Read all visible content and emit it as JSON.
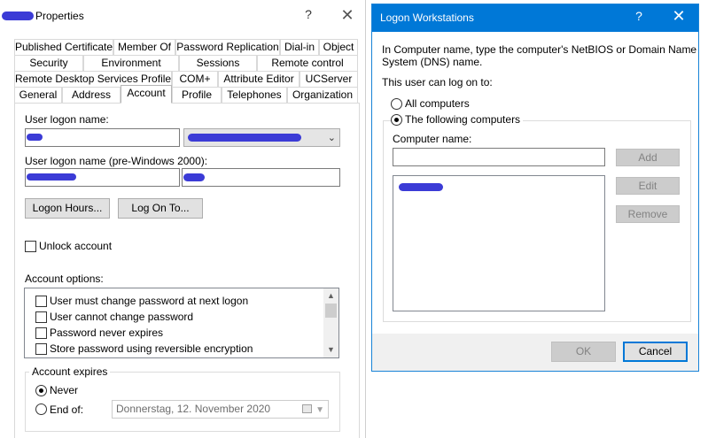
{
  "props_window": {
    "title": "Properties",
    "help": "?",
    "close": "✕",
    "tab_rows": [
      [
        "Published Certificates",
        "Member Of",
        "Password Replication",
        "Dial-in",
        "Object"
      ],
      [
        "Security",
        "Environment",
        "Sessions",
        "Remote control"
      ],
      [
        "Remote Desktop Services Profile",
        "COM+",
        "Attribute Editor",
        "UCServer"
      ],
      [
        "General",
        "Address",
        "Account",
        "Profile",
        "Telephones",
        "Organization"
      ]
    ],
    "active_tab": "Account",
    "account": {
      "logon_name_label": "User logon name:",
      "logon_name_value": "",
      "upn_suffix_value": "",
      "pre2000_label": "User logon name (pre-Windows 2000):",
      "pre2000_domain_value": "",
      "pre2000_user_value": "",
      "logon_hours_button": "Logon Hours...",
      "log_on_to_button": "Log On To...",
      "unlock_label": "Unlock account",
      "options_label": "Account options:",
      "options": [
        "User must change password at next logon",
        "User cannot change password",
        "Password never expires",
        "Store password using reversible encryption"
      ],
      "expires_group": "Account expires",
      "never_label": "Never",
      "end_of_label": "End of:",
      "end_of_date": "Donnerstag, 12. November 2020"
    }
  },
  "logon_dialog": {
    "title": "Logon Workstations",
    "help": "?",
    "close": "✕",
    "intro_line1": "In Computer name, type the computer's NetBIOS or Domain Name",
    "intro_line2": "System (DNS) name.",
    "can_logon_label": "This user can log on to:",
    "all_computers": "All computers",
    "following_computers": "The following computers",
    "computer_name_label": "Computer name:",
    "computer_name_value": "",
    "add_button": "Add",
    "edit_button": "Edit",
    "remove_button": "Remove",
    "computers": [
      ""
    ],
    "ok_button": "OK",
    "cancel_button": "Cancel"
  },
  "colors": {
    "accent": "#0078d7",
    "redaction": "#3b3bd6"
  }
}
